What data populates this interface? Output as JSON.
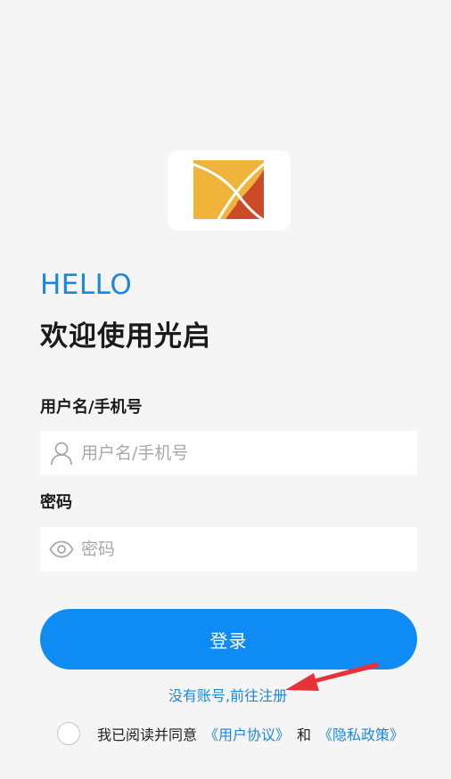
{
  "logo": {
    "icon": "guangqi-logo-icon",
    "colors": {
      "yellow": "#f0b43a",
      "red": "#cc4a28"
    }
  },
  "greeting": {
    "hello": "HELLO",
    "welcome": "欢迎使用光启"
  },
  "username": {
    "label": "用户名/手机号",
    "placeholder": "用户名/手机号",
    "value": "",
    "icon": "user-icon"
  },
  "password": {
    "label": "密码",
    "placeholder": "密码",
    "value": "",
    "icon": "eye-icon"
  },
  "login_button": {
    "label": "登录"
  },
  "register_link": {
    "label": "没有账号,前往注册"
  },
  "agreement": {
    "checked": false,
    "prefix": "我已阅读并同意",
    "user_agreement": "《用户协议》",
    "and": "和",
    "privacy_policy": "《隐私政策》"
  },
  "theme": {
    "accent": "#0e8cf4",
    "link": "#1a87e0",
    "background": "#f5f5f5",
    "annotation_arrow": "#e8323a"
  }
}
